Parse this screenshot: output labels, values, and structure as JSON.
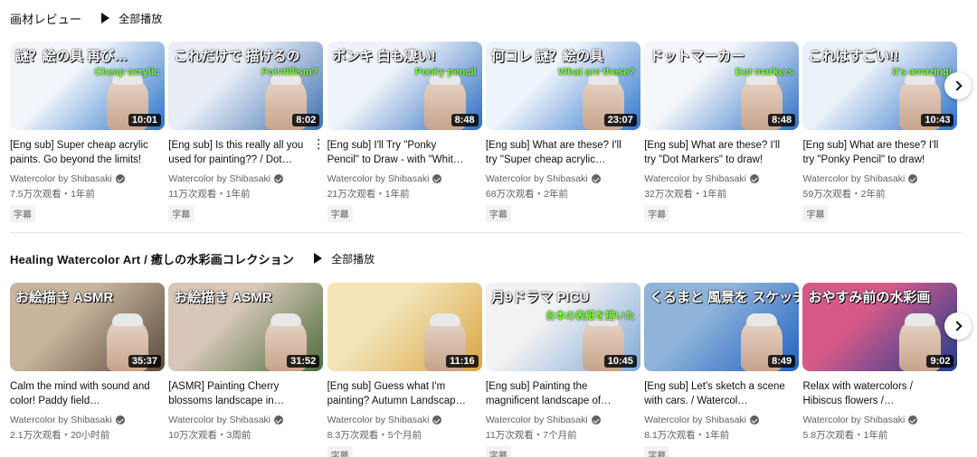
{
  "shelves": [
    {
      "title": "画材レビュー",
      "play_all": "全部播放",
      "videos": [
        {
          "title": "[Eng sub] Super cheap acrylic paints. Go beyond the limits!",
          "channel": "Watercolor by Shibasaki",
          "stats": "7.5万次观看・1年前",
          "badge": "字幕",
          "duration": "10:01",
          "thumb_text": "謎？絵の具 再び…",
          "thumb_sub": "Cheap acrylic",
          "thumb_colors": [
            "#2b73c9",
            "#f2f6fb"
          ]
        },
        {
          "title": "[Eng sub] Is this really all you used for painting?? / Dot…",
          "channel": "Watercolor by Shibasaki",
          "stats": "11万次观看・1年前",
          "badge": "字幕",
          "duration": "8:02",
          "thumb_text": "これだけで 描けるの",
          "thumb_sub": "Pointillism?",
          "thumb_colors": [
            "#3d6fb0",
            "#e9eef6"
          ]
        },
        {
          "title": "[Eng sub] I'll Try \"Ponky Pencil\" to Draw - with \"Whit…",
          "channel": "Watercolor by Shibasaki",
          "stats": "21万次观看・1年前",
          "badge": "字幕",
          "duration": "8:48",
          "thumb_text": "ポンキ 白も凄い!",
          "thumb_sub": "Ponky pencil",
          "thumb_colors": [
            "#2a6bc0",
            "#eef3f9"
          ]
        },
        {
          "title": "[Eng sub] What are these? I'll try \"Super cheap acrylic…",
          "channel": "Watercolor by Shibasaki",
          "stats": "68万次观看・2年前",
          "badge": "字幕",
          "duration": "23:07",
          "thumb_text": "何コレ 謎？絵の具",
          "thumb_sub": "What are these?",
          "thumb_colors": [
            "#2e75cc",
            "#eef4fb"
          ]
        },
        {
          "title": "[Eng sub] What are these? I'll try \"Dot Markers\" to draw!",
          "channel": "Watercolor by Shibasaki",
          "stats": "32万次观看・1年前",
          "badge": "字幕",
          "duration": "8:48",
          "thumb_text": "ドットマーカー",
          "thumb_sub": "Dot markers",
          "thumb_colors": [
            "#2b6fc6",
            "#f3f6fa"
          ]
        },
        {
          "title": "[Eng sub] What are these? I'll try \"Ponky Pencil\" to draw!",
          "channel": "Watercolor by Shibasaki",
          "stats": "59万次观看・2年前",
          "badge": "字幕",
          "duration": "10:43",
          "thumb_text": "これはすごい!!",
          "thumb_sub": "it's amazing!",
          "thumb_colors": [
            "#2c70c8",
            "#eaf1f9"
          ]
        }
      ]
    },
    {
      "title": "Healing Watercolor Art / 癒しの水彩画コレクション",
      "play_all": "全部播放",
      "videos": [
        {
          "title": "Calm the mind with sound and color! Paddy field…",
          "channel": "Watercolor by Shibasaki",
          "stats": "2.1万次观看・20小时前",
          "badge": "",
          "duration": "35:37",
          "thumb_text": "お絵描き ASMR",
          "thumb_sub": "",
          "thumb_colors": [
            "#5a4a3c",
            "#c8b59e"
          ]
        },
        {
          "title": "[ASMR] Painting Cherry blossoms landscape in…",
          "channel": "Watercolor by Shibasaki",
          "stats": "10万次观看・3周前",
          "badge": "",
          "duration": "31:52",
          "thumb_text": "お絵描き ASMR",
          "thumb_sub": "",
          "thumb_colors": [
            "#4b6b3a",
            "#d8c7b8"
          ]
        },
        {
          "title": "[Eng sub] Guess what I'm painting? Autumn Landscap…",
          "channel": "Watercolor by Shibasaki",
          "stats": "8.3万次观看・5个月前",
          "badge": "字幕",
          "duration": "11:16",
          "thumb_text": "",
          "thumb_sub": "",
          "thumb_colors": [
            "#d9a441",
            "#f3e3b7"
          ]
        },
        {
          "title": "[Eng sub] Painting the magnificent landscape of…",
          "channel": "Watercolor by Shibasaki",
          "stats": "11万次观看・7个月前",
          "badge": "字幕",
          "duration": "10:45",
          "thumb_text": "月9ドラマ PICU",
          "thumb_sub": "台本の表紙を描いた",
          "thumb_colors": [
            "#7fa9d6",
            "#f2f2f2"
          ]
        },
        {
          "title": "[Eng sub] Let's sketch a scene with cars. / Watercol…",
          "channel": "Watercolor by Shibasaki",
          "stats": "8.1万次观看・1年前",
          "badge": "字幕",
          "duration": "8:49",
          "thumb_text": "くるまと 風景を スケッチ",
          "thumb_sub": "",
          "thumb_colors": [
            "#1f62c2",
            "#8fb3d9"
          ]
        },
        {
          "title": "Relax with watercolors / Hibiscus flowers /…",
          "channel": "Watercolor by Shibasaki",
          "stats": "5.8万次观看・1年前",
          "badge": "",
          "duration": "9:02",
          "thumb_text": "おやすみ前の水彩画",
          "thumb_sub": "",
          "thumb_colors": [
            "#1e3d8f",
            "#d55a8a"
          ]
        }
      ]
    }
  ]
}
